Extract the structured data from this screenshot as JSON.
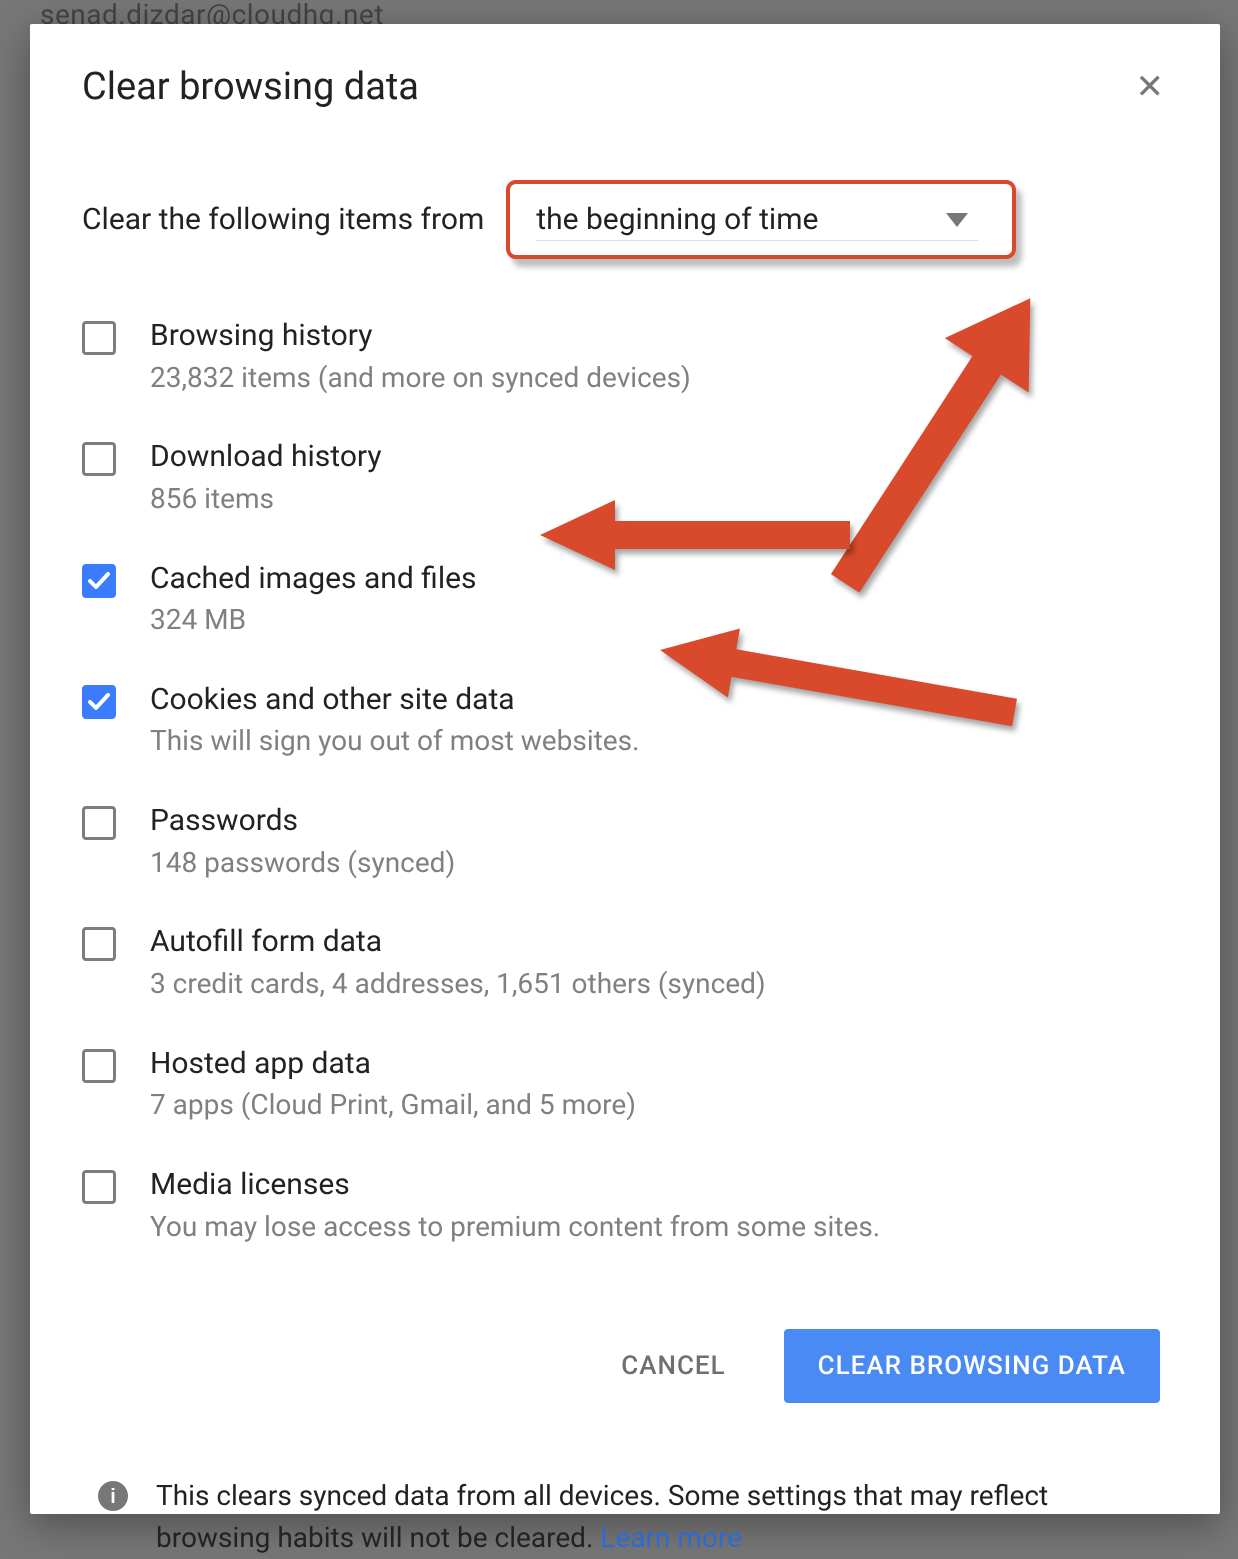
{
  "dialog": {
    "title": "Clear browsing data",
    "from_label": "Clear the following items from",
    "time_range_selected": "the beginning of time",
    "options": [
      {
        "id": "browsing-history",
        "label": "Browsing history",
        "sub": "23,832 items (and more on synced devices)",
        "checked": false
      },
      {
        "id": "download-history",
        "label": "Download history",
        "sub": "856 items",
        "checked": false
      },
      {
        "id": "cached-images",
        "label": "Cached images and files",
        "sub": "324 MB",
        "checked": true
      },
      {
        "id": "cookies",
        "label": "Cookies and other site data",
        "sub": "This will sign you out of most websites.",
        "checked": true
      },
      {
        "id": "passwords",
        "label": "Passwords",
        "sub": "148 passwords (synced)",
        "checked": false
      },
      {
        "id": "autofill",
        "label": "Autofill form data",
        "sub": "3 credit cards, 4 addresses, 1,651 others (synced)",
        "checked": false
      },
      {
        "id": "hosted-app",
        "label": "Hosted app data",
        "sub": "7 apps (Cloud Print, Gmail, and 5 more)",
        "checked": false
      },
      {
        "id": "media-licenses",
        "label": "Media licenses",
        "sub": "You may lose access to premium content from some sites.",
        "checked": false
      }
    ],
    "cancel_label": "CANCEL",
    "confirm_label": "CLEAR BROWSING DATA",
    "footer_text": "This clears synced data from all devices. Some settings that may reflect browsing habits will not be cleared.  ",
    "footer_link": "Learn more"
  },
  "background": {
    "partial_email": "senad.dizdar@cloudhq.net"
  },
  "colors": {
    "accent_blue": "#4a8af4",
    "checkbox_blue": "#3b7cff",
    "annotation_red": "#d9492b",
    "muted_text": "#808080",
    "link_blue": "#2b6bd6"
  }
}
